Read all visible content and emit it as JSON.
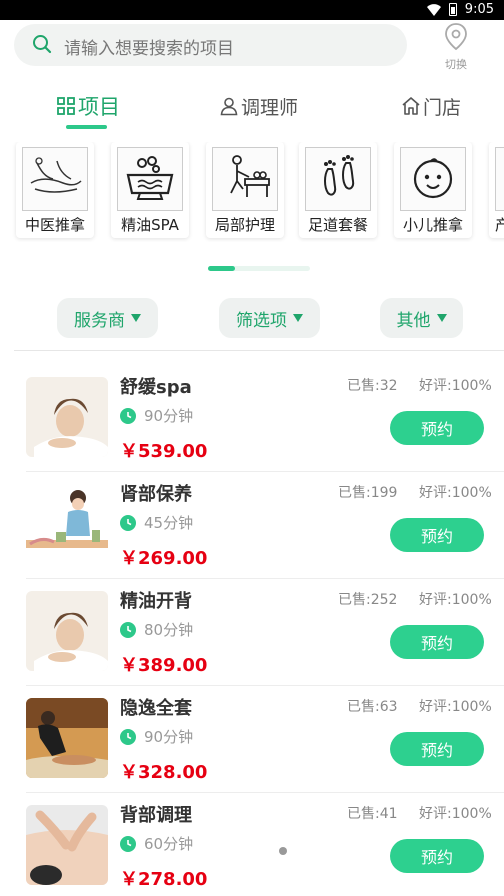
{
  "status_bar": {
    "time": "9:05"
  },
  "search": {
    "placeholder": "请输入想要搜索的项目",
    "icon": "search-icon"
  },
  "switch": {
    "label": "切换",
    "icon": "location-pin-icon"
  },
  "tabs": [
    {
      "label": "项目",
      "icon": "grid-icon",
      "active": true
    },
    {
      "label": "调理师",
      "icon": "person-icon",
      "active": false
    },
    {
      "label": "门店",
      "icon": "home-icon",
      "active": false
    }
  ],
  "categories": [
    {
      "label": "中医推拿",
      "icon": "massage-icon"
    },
    {
      "label": "精油SPA",
      "icon": "spa-tub-icon"
    },
    {
      "label": "局部护理",
      "icon": "local-care-icon"
    },
    {
      "label": "足道套餐",
      "icon": "footprints-icon"
    },
    {
      "label": "小儿推拿",
      "icon": "baby-face-icon"
    },
    {
      "label": "产",
      "icon": "more-icon"
    }
  ],
  "filters": [
    {
      "label": "服务商"
    },
    {
      "label": "筛选项"
    },
    {
      "label": "其他"
    }
  ],
  "items": [
    {
      "name": "舒缓spa",
      "duration": "90分钟",
      "price": "￥539.00",
      "sold": "已售:32",
      "rating": "好评:100%",
      "button": "预约"
    },
    {
      "name": "肾部保养",
      "duration": "45分钟",
      "price": "￥269.00",
      "sold": "已售:199",
      "rating": "好评:100%",
      "button": "预约"
    },
    {
      "name": "精油开背",
      "duration": "80分钟",
      "price": "￥389.00",
      "sold": "已售:252",
      "rating": "好评:100%",
      "button": "预约"
    },
    {
      "name": "隐逸全套",
      "duration": "90分钟",
      "price": "￥328.00",
      "sold": "已售:63",
      "rating": "好评:100%",
      "button": "预约"
    },
    {
      "name": "背部调理",
      "duration": "60分钟",
      "price": "￥278.00",
      "sold": "已售:41",
      "rating": "好评:100%",
      "button": "预约"
    }
  ],
  "colors": {
    "accent": "#2dc88a",
    "accent_text": "#1fa56b",
    "price": "#e60012"
  }
}
